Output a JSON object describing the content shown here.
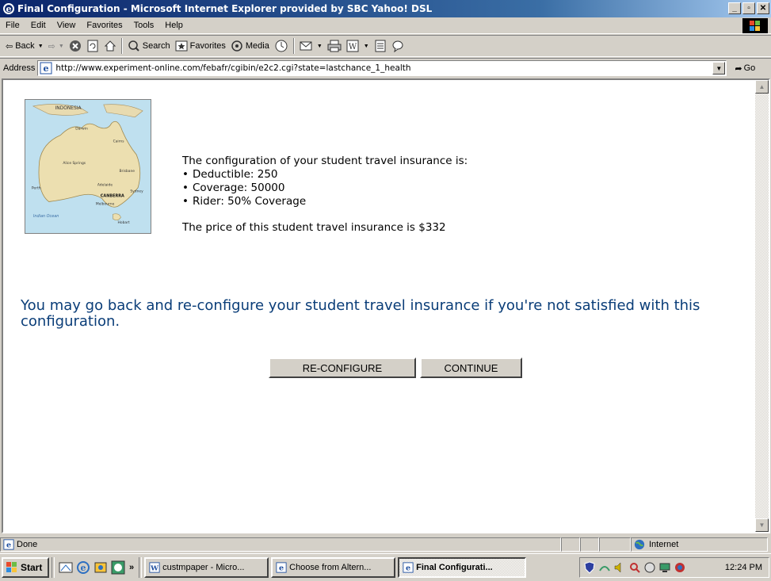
{
  "window": {
    "title": "Final Configuration - Microsoft Internet Explorer provided by SBC Yahoo! DSL"
  },
  "menu": [
    "File",
    "Edit",
    "View",
    "Favorites",
    "Tools",
    "Help"
  ],
  "toolbar": {
    "back": "Back",
    "search": "Search",
    "favorites": "Favorites",
    "media": "Media"
  },
  "address": {
    "label": "Address",
    "url": "http://www.experiment-online.com/febafr/cgibin/e2c2.cgi?state=lastchance_1_health",
    "go": "Go"
  },
  "content": {
    "intro": "The configuration of your student travel insurance is:",
    "items": [
      "Deductible: 250",
      "Coverage: 50000",
      "Rider: 50% Coverage"
    ],
    "price": "The price of this student travel insurance is $332",
    "notice": "You may go back and re-configure your student travel insurance if you're not satisfied with this configuration.",
    "reconfigure_label": "RE-CONFIGURE",
    "continue_label": "CONTINUE",
    "map_labels": {
      "indonesia": "INDONESIA",
      "alice": "Alice Springs",
      "canberra": "CANBERRA",
      "perth": "Perth",
      "sydney": "Sydney",
      "brisbane": "Brisbane",
      "darwin": "Darwin",
      "cairns": "Cairns",
      "adelaide": "Adelaide",
      "melbourne": "Melbourne",
      "hobart": "Hobart",
      "indian_ocean": "Indian Ocean"
    }
  },
  "status": {
    "text": "Done",
    "zone": "Internet"
  },
  "taskbar": {
    "start": "Start",
    "tasks": [
      "custmpaper - Micro...",
      "Choose from Altern...",
      "Final Configurati..."
    ],
    "clock": "12:24 PM"
  },
  "colors": {
    "title_start": "#0a246a",
    "title_end": "#a6caf0",
    "notice_text": "#0a3d78"
  }
}
